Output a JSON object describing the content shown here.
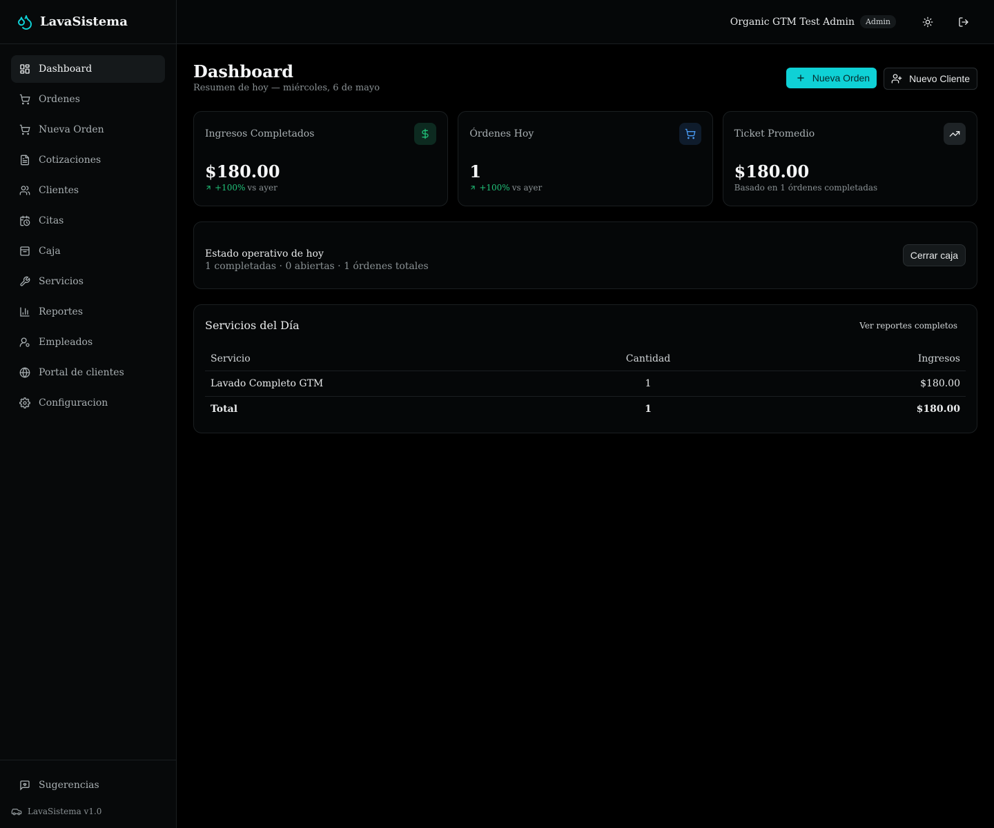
{
  "brand": {
    "name": "LavaSistema"
  },
  "sidebar": {
    "items": [
      {
        "label": "Dashboard",
        "icon": "dashboard-icon",
        "active": true
      },
      {
        "label": "Ordenes",
        "icon": "cart-icon"
      },
      {
        "label": "Nueva Orden",
        "icon": "cart-icon"
      },
      {
        "label": "Cotizaciones",
        "icon": "document-icon"
      },
      {
        "label": "Clientes",
        "icon": "users-icon"
      },
      {
        "label": "Citas",
        "icon": "calendar-clock-icon"
      },
      {
        "label": "Caja",
        "icon": "archive-icon"
      },
      {
        "label": "Servicios",
        "icon": "wrench-icon"
      },
      {
        "label": "Reportes",
        "icon": "bar-chart-icon"
      },
      {
        "label": "Empleados",
        "icon": "user-gear-icon"
      },
      {
        "label": "Portal de clientes",
        "icon": "globe-icon"
      },
      {
        "label": "Configuracion",
        "icon": "gear-icon"
      }
    ],
    "suggestions_label": "Sugerencias",
    "version": "LavaSistema v1.0"
  },
  "topbar": {
    "user_name": "Organic GTM Test Admin",
    "role": "Admin"
  },
  "page": {
    "title": "Dashboard",
    "subtitle": "Resumen de hoy — miércoles, 6 de mayo",
    "new_order_label": "Nueva Orden",
    "new_client_label": "Nuevo Cliente"
  },
  "cards": {
    "income": {
      "label": "Ingresos Completados",
      "value": "$180.00",
      "delta": "+100%",
      "delta_suffix": "vs ayer"
    },
    "orders": {
      "label": "Órdenes Hoy",
      "value": "1",
      "delta": "+100%",
      "delta_suffix": "vs ayer"
    },
    "ticket": {
      "label": "Ticket Promedio",
      "value": "$180.00",
      "note": "Basado en 1 órdenes completadas"
    }
  },
  "status": {
    "title": "Estado operativo de hoy",
    "meta": "1 completadas · 0 abiertas · 1 órdenes totales",
    "close_label": "Cerrar caja"
  },
  "services": {
    "title": "Servicios del Día",
    "link": "Ver reportes completos",
    "headers": {
      "service": "Servicio",
      "qty": "Cantidad",
      "income": "Ingresos"
    },
    "rows": [
      {
        "service": "Lavado Completo GTM",
        "qty": "1",
        "income": "$180.00"
      }
    ],
    "total": {
      "label": "Total",
      "qty": "1",
      "income": "$180.00"
    }
  },
  "colors": {
    "accent": "#0fd1d6",
    "positive": "#21c37a",
    "blue": "#4a9cf5"
  }
}
